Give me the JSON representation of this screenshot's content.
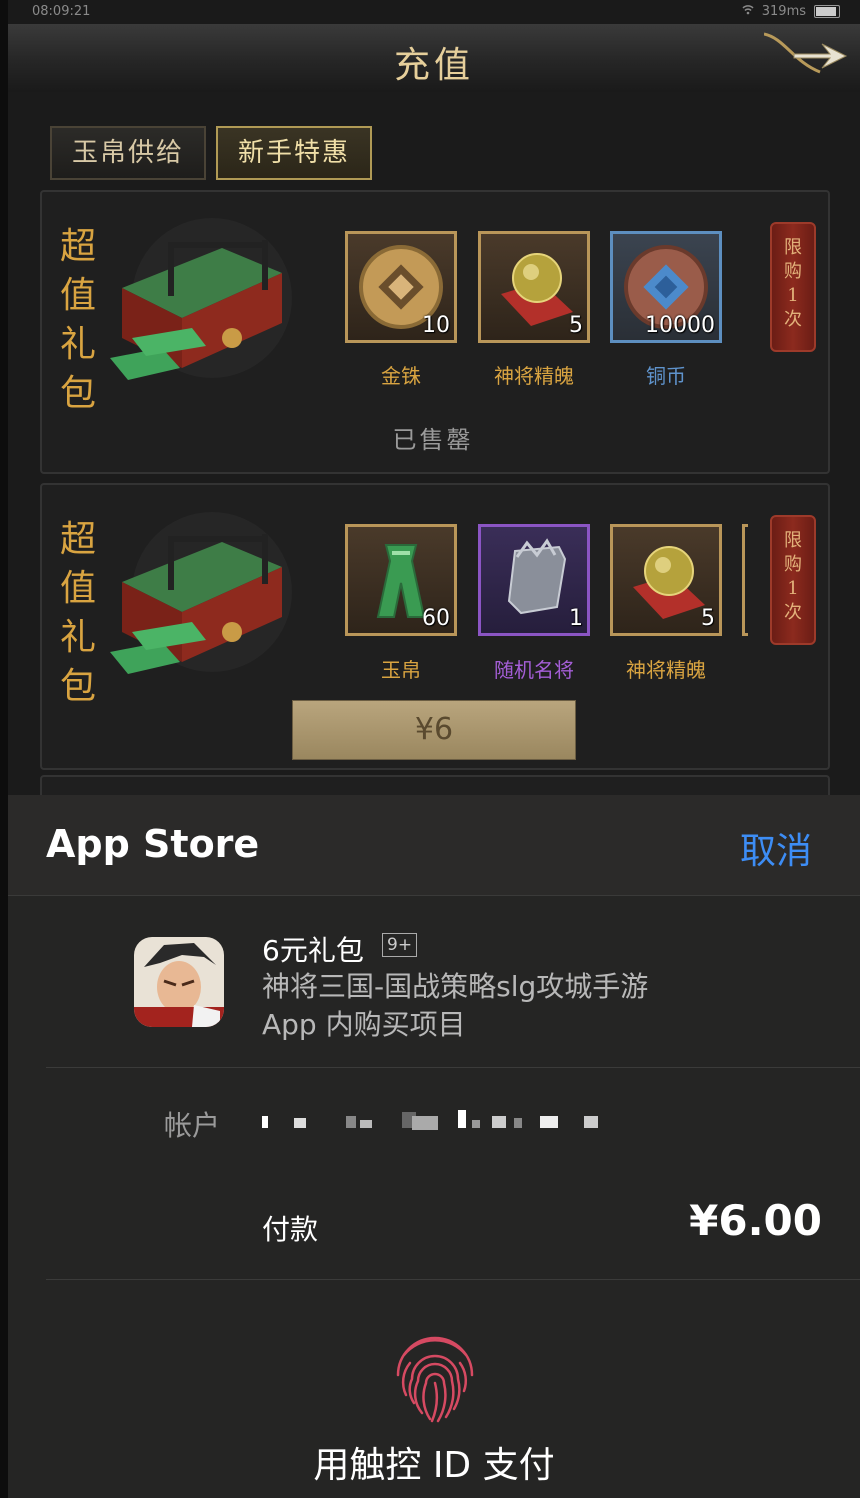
{
  "status_bar": {
    "time": "08:09:21",
    "latency": "319ms"
  },
  "header": {
    "title": "充值"
  },
  "tabs": [
    {
      "label": "玉帛供给"
    },
    {
      "label": "新手特惠"
    }
  ],
  "packages": [
    {
      "gift_word": [
        "超",
        "值",
        "礼",
        "包"
      ],
      "items": [
        {
          "name": "金铢",
          "count": "10",
          "icon": "gold-coin-icon"
        },
        {
          "name": "神将精魄",
          "count": "5",
          "icon": "spirit-orb-icon"
        },
        {
          "name": "铜币",
          "count": "10000",
          "icon": "copper-coin-icon"
        }
      ],
      "limit_tag": [
        "限",
        "购",
        "1",
        "次"
      ],
      "status": "已售罄"
    },
    {
      "gift_word": [
        "超",
        "值",
        "礼",
        "包"
      ],
      "items": [
        {
          "name": "玉帛",
          "count": "60",
          "icon": "jade-token-icon"
        },
        {
          "name": "随机名将",
          "count": "1",
          "icon": "general-token-icon"
        },
        {
          "name": "神将精魄",
          "count": "5",
          "icon": "spirit-orb-icon"
        }
      ],
      "limit_tag": [
        "限",
        "购",
        "1",
        "次"
      ],
      "price": "¥6"
    }
  ],
  "payment_sheet": {
    "title": "App Store",
    "cancel": "取消",
    "product_name": "6元礼包",
    "age_rating": "9+",
    "developer": "神将三国-国战策略slg攻城手游",
    "purchase_type": "App 内购买项目",
    "account_label": "帐户",
    "pay_label": "付款",
    "pay_amount": "¥6.00",
    "touch_id_prompt": "用触控 ID 支付"
  },
  "colors": {
    "accent_blue": "#3d8df5",
    "gold": "#d9a441",
    "fingerprint": "#d64a62"
  }
}
